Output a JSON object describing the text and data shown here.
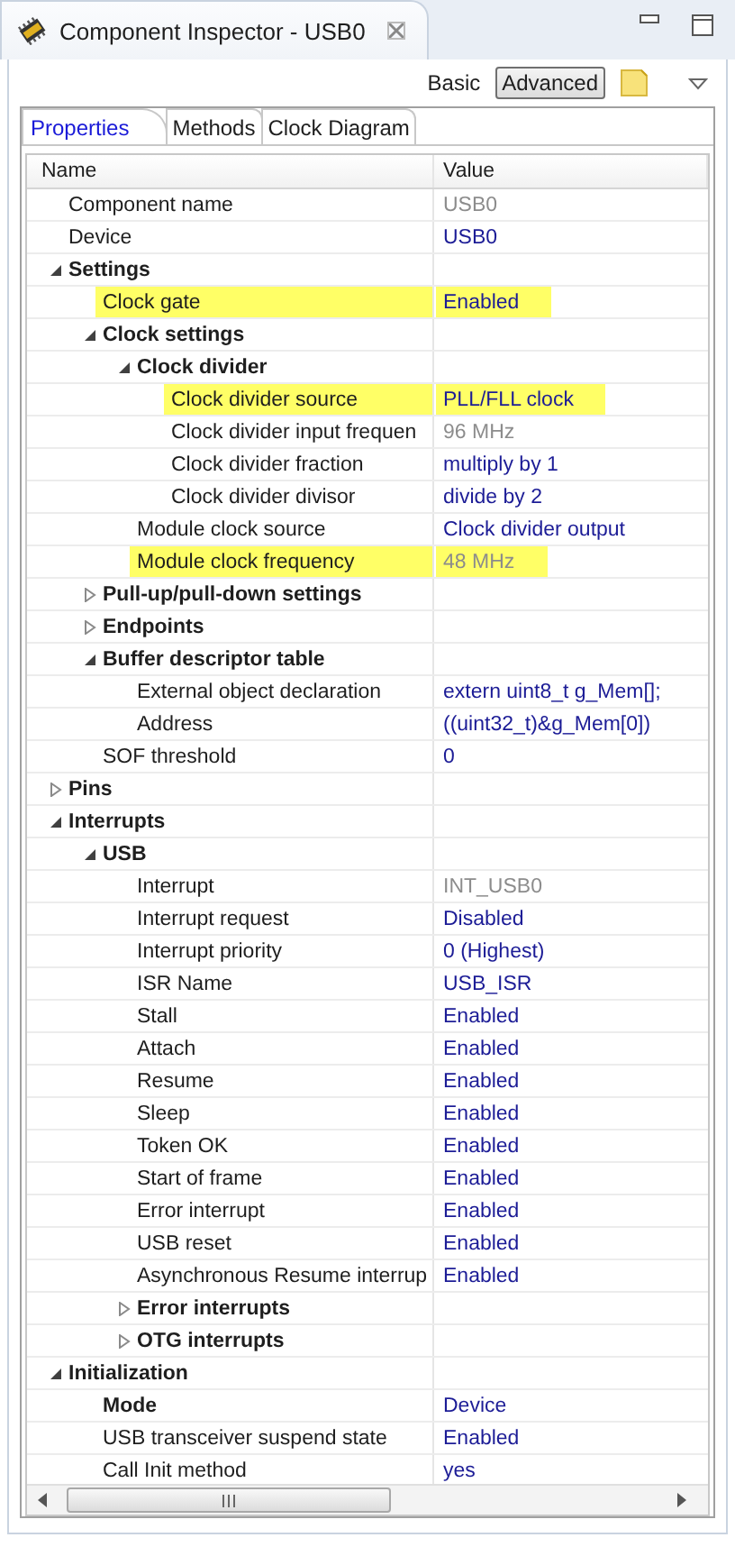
{
  "view": {
    "title": "Component Inspector - USB0"
  },
  "mode_buttons": [
    {
      "label": "Basic",
      "selected": false
    },
    {
      "label": "Advanced",
      "selected": true
    }
  ],
  "tabs": [
    {
      "label": "Properties",
      "selected": true
    },
    {
      "label": "Methods",
      "selected": false
    },
    {
      "label": "Clock Diagram",
      "selected": false
    }
  ],
  "table": {
    "columns": [
      "Name",
      "Value"
    ],
    "rows": [
      {
        "kind": "property",
        "name": "Component name",
        "value": "USB0",
        "readonly": true
      },
      {
        "kind": "property",
        "name": "Device",
        "value": "USB0"
      },
      {
        "kind": "group",
        "name": "Settings",
        "expanded": true,
        "children": [
          {
            "kind": "property",
            "name": "Clock gate",
            "value": "Enabled",
            "highlighted": true
          },
          {
            "kind": "group",
            "name": "Clock settings",
            "expanded": true,
            "children": [
              {
                "kind": "group",
                "name": "Clock divider",
                "expanded": true,
                "children": [
                  {
                    "kind": "property",
                    "name": "Clock divider source",
                    "value": "PLL/FLL clock",
                    "highlighted": true
                  },
                  {
                    "kind": "property",
                    "name": "Clock divider input frequen",
                    "value": "96 MHz",
                    "readonly": true
                  },
                  {
                    "kind": "property",
                    "name": "Clock divider fraction",
                    "value": "multiply by 1"
                  },
                  {
                    "kind": "property",
                    "name": "Clock divider divisor",
                    "value": "divide by 2"
                  }
                ]
              },
              {
                "kind": "property",
                "name": "Module clock source",
                "value": "Clock divider output"
              },
              {
                "kind": "property",
                "name": "Module clock frequency",
                "value": "48 MHz",
                "readonly": true,
                "highlighted": true
              }
            ]
          },
          {
            "kind": "group",
            "name": "Pull-up/pull-down settings",
            "expanded": false
          },
          {
            "kind": "group",
            "name": "Endpoints",
            "expanded": false
          },
          {
            "kind": "group",
            "name": "Buffer descriptor table",
            "expanded": true,
            "children": [
              {
                "kind": "property",
                "name": "External object declaration",
                "value": "extern uint8_t g_Mem[];"
              },
              {
                "kind": "property",
                "name": "Address",
                "value": "((uint32_t)&g_Mem[0])"
              }
            ]
          },
          {
            "kind": "property",
            "name": "SOF threshold",
            "value": "0"
          }
        ]
      },
      {
        "kind": "group",
        "name": "Pins",
        "expanded": false
      },
      {
        "kind": "group",
        "name": "Interrupts",
        "expanded": true,
        "children": [
          {
            "kind": "group",
            "name": "USB",
            "expanded": true,
            "children": [
              {
                "kind": "property",
                "name": "Interrupt",
                "value": "INT_USB0",
                "readonly": true
              },
              {
                "kind": "property",
                "name": "Interrupt request",
                "value": "Disabled"
              },
              {
                "kind": "property",
                "name": "Interrupt priority",
                "value": "0 (Highest)"
              },
              {
                "kind": "property",
                "name": "ISR Name",
                "value": "USB_ISR"
              },
              {
                "kind": "property",
                "name": "Stall",
                "value": "Enabled"
              },
              {
                "kind": "property",
                "name": "Attach",
                "value": "Enabled"
              },
              {
                "kind": "property",
                "name": "Resume",
                "value": "Enabled"
              },
              {
                "kind": "property",
                "name": "Sleep",
                "value": "Enabled"
              },
              {
                "kind": "property",
                "name": "Token OK",
                "value": "Enabled"
              },
              {
                "kind": "property",
                "name": "Start of frame",
                "value": "Enabled"
              },
              {
                "kind": "property",
                "name": "Error interrupt",
                "value": "Enabled"
              },
              {
                "kind": "property",
                "name": "USB reset",
                "value": "Enabled"
              },
              {
                "kind": "property",
                "name": "Asynchronous Resume interrup",
                "value": "Enabled"
              },
              {
                "kind": "group",
                "name": "Error interrupts",
                "expanded": false
              },
              {
                "kind": "group",
                "name": "OTG interrupts",
                "expanded": false
              }
            ]
          }
        ]
      },
      {
        "kind": "group",
        "name": "Initialization",
        "expanded": true,
        "children": [
          {
            "kind": "property",
            "name": "Mode",
            "value": "Device",
            "bold": true
          },
          {
            "kind": "property",
            "name": "USB transceiver suspend state",
            "value": "Enabled"
          },
          {
            "kind": "property",
            "name": "Call Init method",
            "value": "yes"
          }
        ]
      }
    ]
  }
}
